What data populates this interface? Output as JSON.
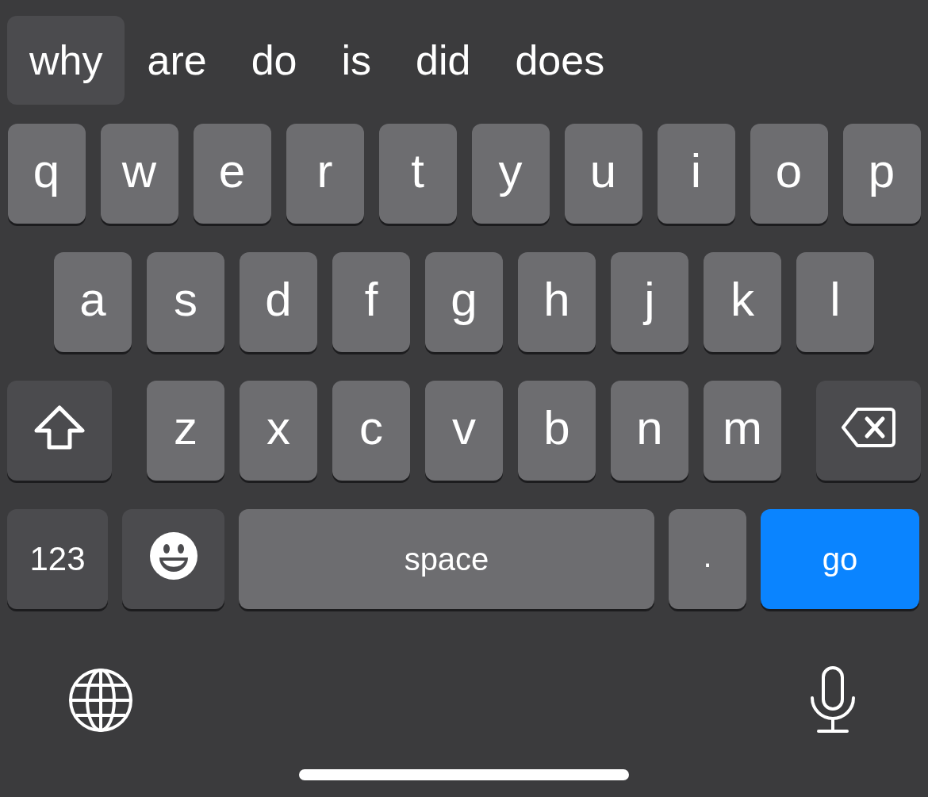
{
  "suggestions": [
    {
      "text": "why",
      "selected": true
    },
    {
      "text": "are",
      "selected": false
    },
    {
      "text": "do",
      "selected": false
    },
    {
      "text": "is",
      "selected": false
    },
    {
      "text": "did",
      "selected": false
    },
    {
      "text": "does",
      "selected": false
    }
  ],
  "rows": [
    [
      {
        "kind": "letter",
        "label": "q"
      },
      {
        "kind": "letter",
        "label": "w"
      },
      {
        "kind": "letter",
        "label": "e"
      },
      {
        "kind": "letter",
        "label": "r"
      },
      {
        "kind": "letter",
        "label": "t"
      },
      {
        "kind": "letter",
        "label": "y"
      },
      {
        "kind": "letter",
        "label": "u"
      },
      {
        "kind": "letter",
        "label": "i"
      },
      {
        "kind": "letter",
        "label": "o"
      },
      {
        "kind": "letter",
        "label": "p"
      }
    ],
    [
      {
        "kind": "letter",
        "label": "a"
      },
      {
        "kind": "letter",
        "label": "s"
      },
      {
        "kind": "letter",
        "label": "d"
      },
      {
        "kind": "letter",
        "label": "f"
      },
      {
        "kind": "letter",
        "label": "g"
      },
      {
        "kind": "letter",
        "label": "h"
      },
      {
        "kind": "letter",
        "label": "j"
      },
      {
        "kind": "letter",
        "label": "k"
      },
      {
        "kind": "letter",
        "label": "l"
      }
    ],
    [
      {
        "kind": "shift"
      },
      {
        "kind": "letter",
        "label": "z"
      },
      {
        "kind": "letter",
        "label": "x"
      },
      {
        "kind": "letter",
        "label": "c"
      },
      {
        "kind": "letter",
        "label": "v"
      },
      {
        "kind": "letter",
        "label": "b"
      },
      {
        "kind": "letter",
        "label": "n"
      },
      {
        "kind": "letter",
        "label": "m"
      },
      {
        "kind": "backspace"
      }
    ],
    [
      {
        "kind": "numbers",
        "label": "123"
      },
      {
        "kind": "emoji"
      },
      {
        "kind": "space",
        "label": "space"
      },
      {
        "kind": "period",
        "label": "."
      },
      {
        "kind": "go",
        "label": "go"
      }
    ]
  ]
}
